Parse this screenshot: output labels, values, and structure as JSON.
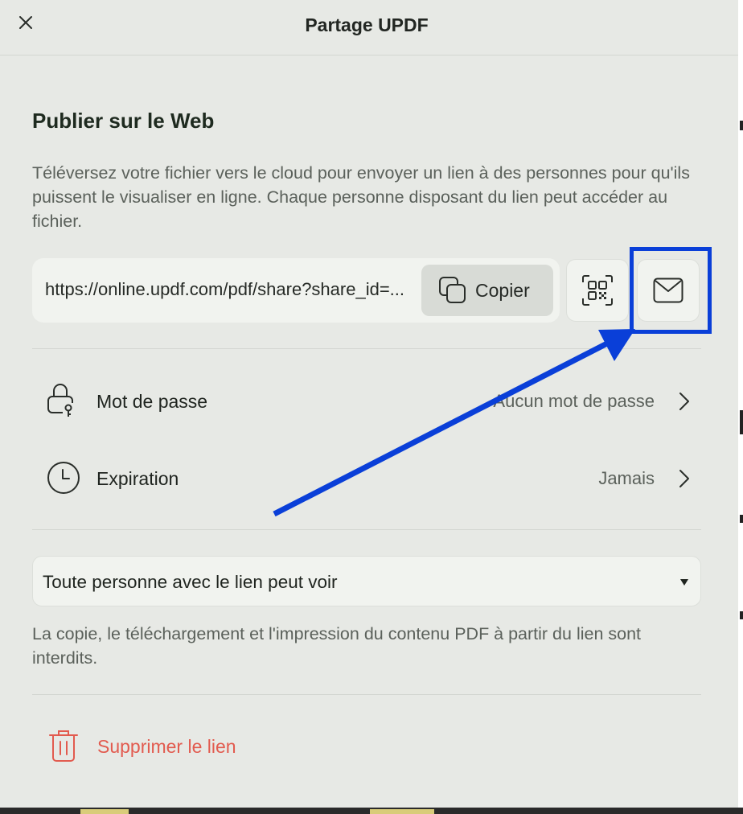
{
  "header": {
    "title": "Partage UPDF",
    "close_icon": "close-icon"
  },
  "publish": {
    "title": "Publier sur le Web",
    "description": "Téléversez votre fichier vers le cloud pour envoyer un lien à des personnes pour qu'ils puissent le visualiser en ligne. Chaque personne disposant du lien peut accéder au fichier.",
    "link": "https://online.updf.com/pdf/share?share_id=...",
    "copy_label": "Copier",
    "copy_icon": "copy-icon",
    "qr_icon": "qr-code-icon",
    "mail_icon": "mail-icon"
  },
  "settings": {
    "password": {
      "label": "Mot de passe",
      "value": "Aucun mot de passe",
      "icon": "lock-icon"
    },
    "expiration": {
      "label": "Expiration",
      "value": "Jamais",
      "icon": "clock-icon"
    }
  },
  "access": {
    "selected": "Toute personne avec le lien peut voir",
    "note": "La copie, le téléchargement et l'impression du contenu PDF à partir du lien sont interdits."
  },
  "delete": {
    "label": "Supprimer le lien",
    "icon": "trash-icon"
  },
  "colors": {
    "annotation": "#0a3fd8",
    "danger": "#e25b4f",
    "background": "#e7e9e5"
  }
}
